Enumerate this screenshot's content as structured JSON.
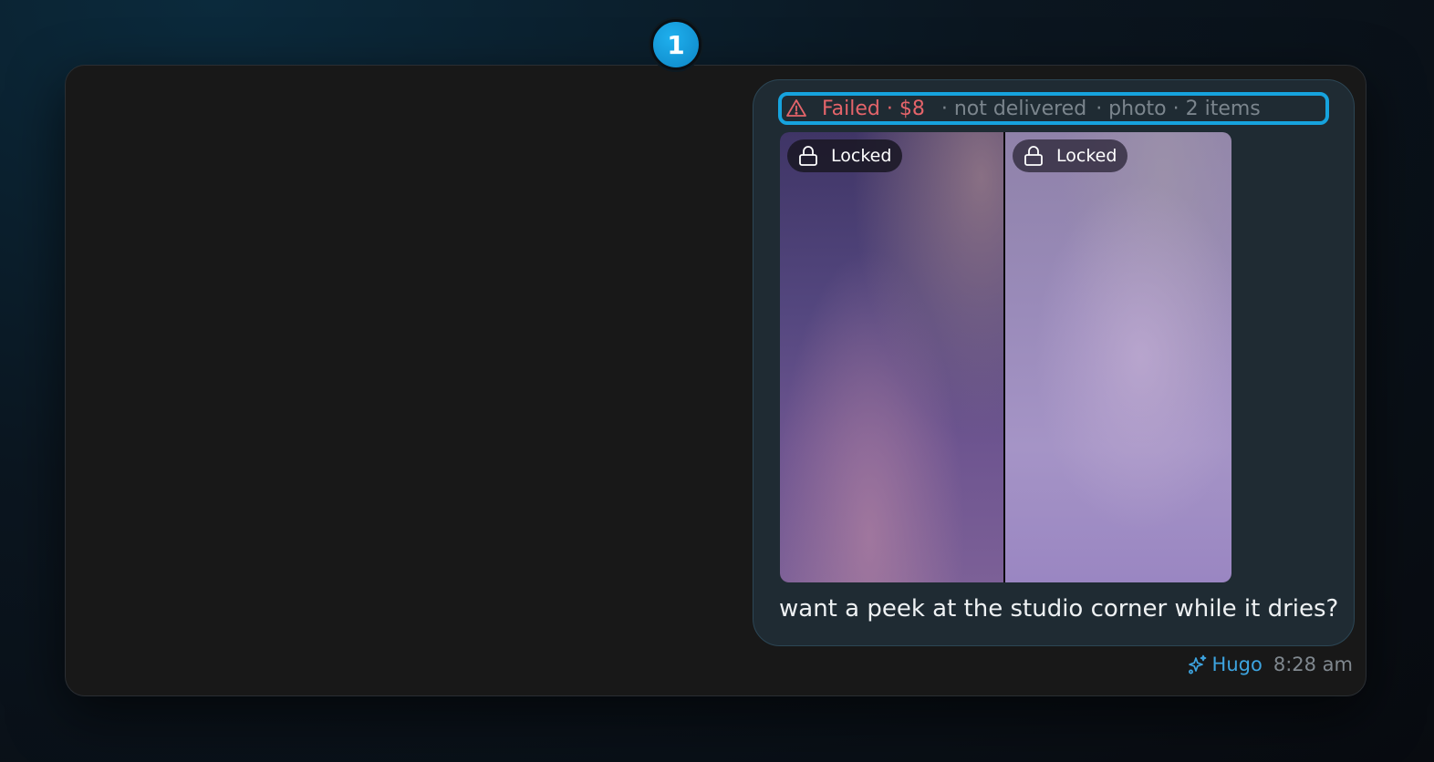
{
  "message": {
    "step_number": "1",
    "status": {
      "failed_label": "Failed · $8",
      "delivery": "· not delivered",
      "details": "· photo · 2 items"
    },
    "photos": [
      {
        "lock_label": "Locked"
      },
      {
        "lock_label": "Locked"
      }
    ],
    "caption": "want a peek at the studio corner while it dries?",
    "author": "Hugo",
    "time": "8:28 am",
    "icons": {
      "status": "warning-triangle-icon",
      "lock": "lock-icon",
      "author": "sparkle-icon"
    },
    "colors": {
      "failed": "#e4646a",
      "accent": "#16a3de",
      "author": "#3da4e0"
    }
  }
}
